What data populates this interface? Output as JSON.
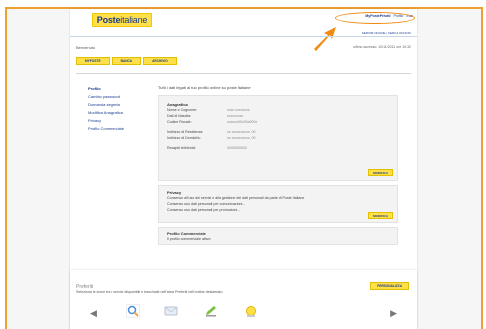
{
  "brand": {
    "poste": "Poste",
    "italiane": "italiane"
  },
  "header": {
    "links": [
      "MyPostePrivati",
      "Profilo",
      "Esci"
    ],
    "sub_links": "SERVIZI ONLINE | CERCA UFFICIO"
  },
  "welcome": "Benvenuto",
  "last_access": "ultimo accesso: 10/11/2011 ore 10:32",
  "nav": [
    "MYPOSTE",
    "BANCA",
    "ARCHIVIO"
  ],
  "sidebar": {
    "items": [
      {
        "label": "Profilo",
        "active": true
      },
      {
        "label": "Cambio password"
      },
      {
        "label": "Domanda segreta"
      },
      {
        "label": "Modifica Anagrafica"
      },
      {
        "label": "Privacy"
      },
      {
        "label": "Profilo Commerciale"
      }
    ]
  },
  "intro": "Tutti i dati legati al tuo profilo online su poste italiane",
  "anagrafica": {
    "title": "Anagrafica",
    "rows": [
      {
        "label": "Nome e Cognome:",
        "value": "xxxx xxxxxxxx"
      },
      {
        "label": "Dati di Nascita:",
        "value": "xxxxxxxxx"
      },
      {
        "label": "Codice Fiscale:",
        "value": "xxxxxx00x00x000x"
      }
    ],
    "rows2": [
      {
        "label": "Indirizzo di Residenza:",
        "value": "xx xxxxxxxxxx, 00"
      },
      {
        "label": "Indirizzo di Domicilio:",
        "value": "xx xxxxxxxxxx, 00"
      }
    ],
    "rows3": [
      {
        "label": "Recapiti telefonici:",
        "value": "0000000000"
      }
    ],
    "button": "MODIFICA"
  },
  "privacy": {
    "title": "Privacy",
    "lines": [
      "Consenso all'uso dei servizi e alla gestione dei dati personali da parte di Poste Italiane",
      "Consenso uso dati personali per comunicazioni...",
      "Consenso uso dati personali per promozioni..."
    ],
    "button": "MODIFICA"
  },
  "commerciale": {
    "title": "Profilo Commerciale",
    "status": "Il profilo commerciale attivo"
  },
  "preferiti": {
    "title": "Preferiti",
    "desc": "Seleziona le icone tra i servizi disponibili e trascinale nell'area Preferiti nell'ordine desiderato.",
    "button": "PERSONALIZZA",
    "icons": [
      "search-icon",
      "envelope-icon",
      "pencil-icon",
      "globe-icon"
    ]
  },
  "colors": {
    "accent": "#ffe04a",
    "brand": "#1b3b8c",
    "highlight": "#f08a10"
  }
}
